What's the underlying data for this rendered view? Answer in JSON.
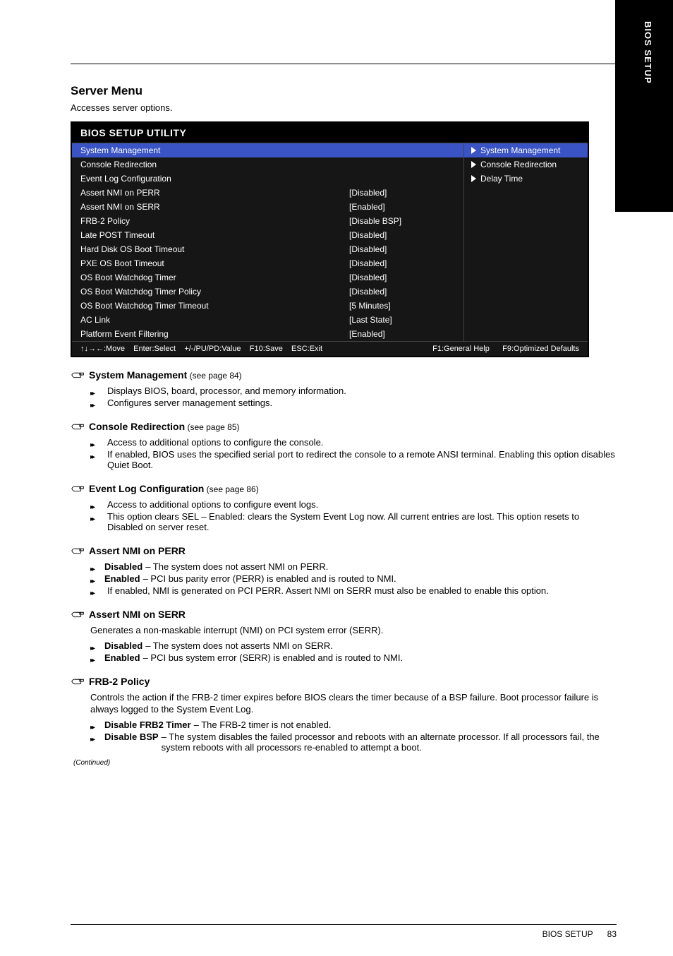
{
  "sidebar_tab": "BIOS SETUP",
  "section": {
    "title": "Server Menu",
    "sub": "Accesses server options."
  },
  "osd": {
    "title": "BIOS SETUP UTILITY",
    "left_rows": [
      {
        "label": "System Management",
        "value": "",
        "selected": true
      },
      {
        "label": "Console Redirection",
        "value": "",
        "selected": false
      },
      {
        "label": "Event Log Configuration",
        "value": "",
        "selected": false
      },
      {
        "label": "Assert NMI on PERR",
        "value": "[Disabled]",
        "selected": false
      },
      {
        "label": "Assert NMI on SERR",
        "value": "[Enabled]",
        "selected": false
      },
      {
        "label": "FRB-2 Policy",
        "value": "[Disable BSP]",
        "selected": false
      },
      {
        "label": "Late POST Timeout",
        "value": "[Disabled]",
        "selected": false
      },
      {
        "label": "Hard Disk OS Boot Timeout",
        "value": "[Disabled]",
        "selected": false
      },
      {
        "label": "PXE OS Boot Timeout",
        "value": "[Disabled]",
        "selected": false
      },
      {
        "label": "OS Boot Watchdog Timer",
        "value": "[Disabled]",
        "selected": false
      },
      {
        "label": "OS Boot Watchdog Timer Policy",
        "value": "[Disabled]",
        "selected": false
      },
      {
        "label": "OS Boot Watchdog Timer Timeout",
        "value": "[5 Minutes]",
        "selected": false
      },
      {
        "label": "AC Link",
        "value": "[Last State]",
        "selected": false
      },
      {
        "label": "Platform Event Filtering",
        "value": "[Enabled]",
        "selected": false
      }
    ],
    "right_items": [
      {
        "label": "System Management",
        "selected": true
      },
      {
        "label": "Console Redirection",
        "selected": false
      },
      {
        "label": "Delay Time",
        "selected": false
      }
    ],
    "footer_left": "↑↓→←:Move    Enter:Select    +/-/PU/PD:Value    F10:Save    ESC:Exit",
    "footer_right": "F1:General Help      F9:Optimized Defaults"
  },
  "items": [
    {
      "title": "System Management",
      "ref": "(see page 84)",
      "options": [
        {
          "lbl": "",
          "desc": "Displays BIOS, board, processor, and memory information."
        },
        {
          "lbl": "",
          "desc": "Configures server management settings."
        }
      ]
    },
    {
      "title": "Console Redirection",
      "ref": "(see page 85)",
      "options": [
        {
          "lbl": "",
          "desc": "Access to additional options to configure the console."
        },
        {
          "lbl": "",
          "desc": "If enabled, BIOS uses the specified serial port to redirect the console to a remote ANSI terminal. Enabling this option disables Quiet Boot."
        }
      ]
    },
    {
      "title": "Event Log Configuration",
      "ref": "(see page 86)",
      "options": [
        {
          "lbl": "",
          "desc": "Access to additional options to configure event logs."
        },
        {
          "lbl": "",
          "desc": "This option clears SEL – Enabled: clears the System Event Log now. All current entries are lost. This option resets to Disabled on server reset."
        }
      ]
    },
    {
      "title": "Assert NMI on PERR",
      "options": [
        {
          "lbl": "Disabled",
          "desc": "– The system does not assert NMI on PERR."
        },
        {
          "lbl": "Enabled",
          "desc": "– PCI bus parity error (PERR) is enabled and is routed to NMI."
        },
        {
          "lbl": "",
          "desc": "If enabled, NMI is generated on PCI PERR. Assert NMI on SERR must also be enabled to enable this option."
        }
      ]
    },
    {
      "title": "Assert NMI on SERR",
      "body": "Generates a non-maskable interrupt (NMI) on PCI system error (SERR).",
      "options": [
        {
          "lbl": "Disabled",
          "desc": "– The system does not asserts NMI on SERR."
        },
        {
          "lbl": "Enabled",
          "desc": "– PCI bus system error (SERR) is enabled and is routed to NMI."
        }
      ]
    },
    {
      "title": "FRB-2 Policy",
      "body": "Controls the action if the FRB-2 timer expires before BIOS clears the timer because of a BSP failure. Boot processor failure is always logged to the System Event Log.",
      "options": [
        {
          "lbl": "Disable FRB2 Timer",
          "desc": "– The FRB-2 timer is not enabled."
        },
        {
          "lbl": "Disable BSP",
          "desc": "– The system disables the failed processor and reboots with an alternate processor. If all processors fail, the system reboots with all processors re-enabled to attempt a boot."
        }
      ]
    }
  ],
  "continued": "(Continued)",
  "footer": {
    "left": "BIOS SETUP",
    "right": "83"
  }
}
